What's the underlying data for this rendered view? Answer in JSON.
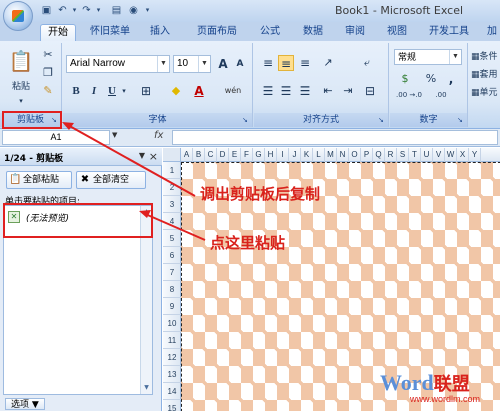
{
  "titlebar": {
    "title": "Book1 - Microsoft Excel"
  },
  "qat": {
    "icons": [
      "save-icon",
      "undo-icon",
      "redo-icon",
      "print-preview-icon",
      "camera-icon",
      "customize-dropdown-icon"
    ]
  },
  "tabs": [
    {
      "label": "开始",
      "active": true
    },
    {
      "label": "怀旧菜单"
    },
    {
      "label": "插入"
    },
    {
      "label": "页面布局"
    },
    {
      "label": "公式"
    },
    {
      "label": "数据"
    },
    {
      "label": "审阅"
    },
    {
      "label": "视图"
    },
    {
      "label": "开发工具"
    },
    {
      "label": "加"
    }
  ],
  "ribbon": {
    "clipboard": {
      "label": "剪贴板",
      "paste": "粘贴"
    },
    "font": {
      "label": "字体",
      "font_name": "Arial Narrow",
      "font_size": "10",
      "grow": "A",
      "shrink": "A",
      "bold": "B",
      "italic": "I",
      "underline": "U",
      "phonetic": "wén"
    },
    "alignment": {
      "label": "对齐方式"
    },
    "number": {
      "label": "数字",
      "format": "常规",
      "currency": "$",
      "percent": "%",
      "comma": ",",
      "inc_decimal": ".00\n→.0",
      "dec_decimal": ".00"
    },
    "styles": {
      "item1": "条件",
      "item2": "套用",
      "item3": "单元"
    }
  },
  "formulabar": {
    "namebox": "A1",
    "fx": "fx"
  },
  "pane": {
    "title": "1/24 - 剪贴板",
    "paste_all": "全部粘贴",
    "clear_all": "全部清空",
    "hint": "单击要粘贴的项目:",
    "item_text": "(无法预览)",
    "options": "选项 ▼"
  },
  "sheet": {
    "columns": [
      "A",
      "B",
      "C",
      "D",
      "E",
      "F",
      "G",
      "H",
      "I",
      "J",
      "K",
      "L",
      "M",
      "N",
      "O",
      "P",
      "Q",
      "R",
      "S",
      "T",
      "U",
      "V",
      "W",
      "X",
      "Y"
    ],
    "rows": [
      "1",
      "2",
      "3",
      "4",
      "5",
      "6",
      "7",
      "8",
      "9",
      "10",
      "11",
      "12",
      "13",
      "14",
      "15"
    ]
  },
  "annotations": {
    "callout1": "调出剪贴板后复制",
    "callout2": "点这里粘贴"
  },
  "watermark": {
    "brand": "Word",
    "brand_cn": "联盟",
    "url": "www.wordlm.com"
  },
  "colors": {
    "annotation": "#d9221c",
    "checker": "#f1c6a7",
    "ribbon": "#dae7f6"
  }
}
